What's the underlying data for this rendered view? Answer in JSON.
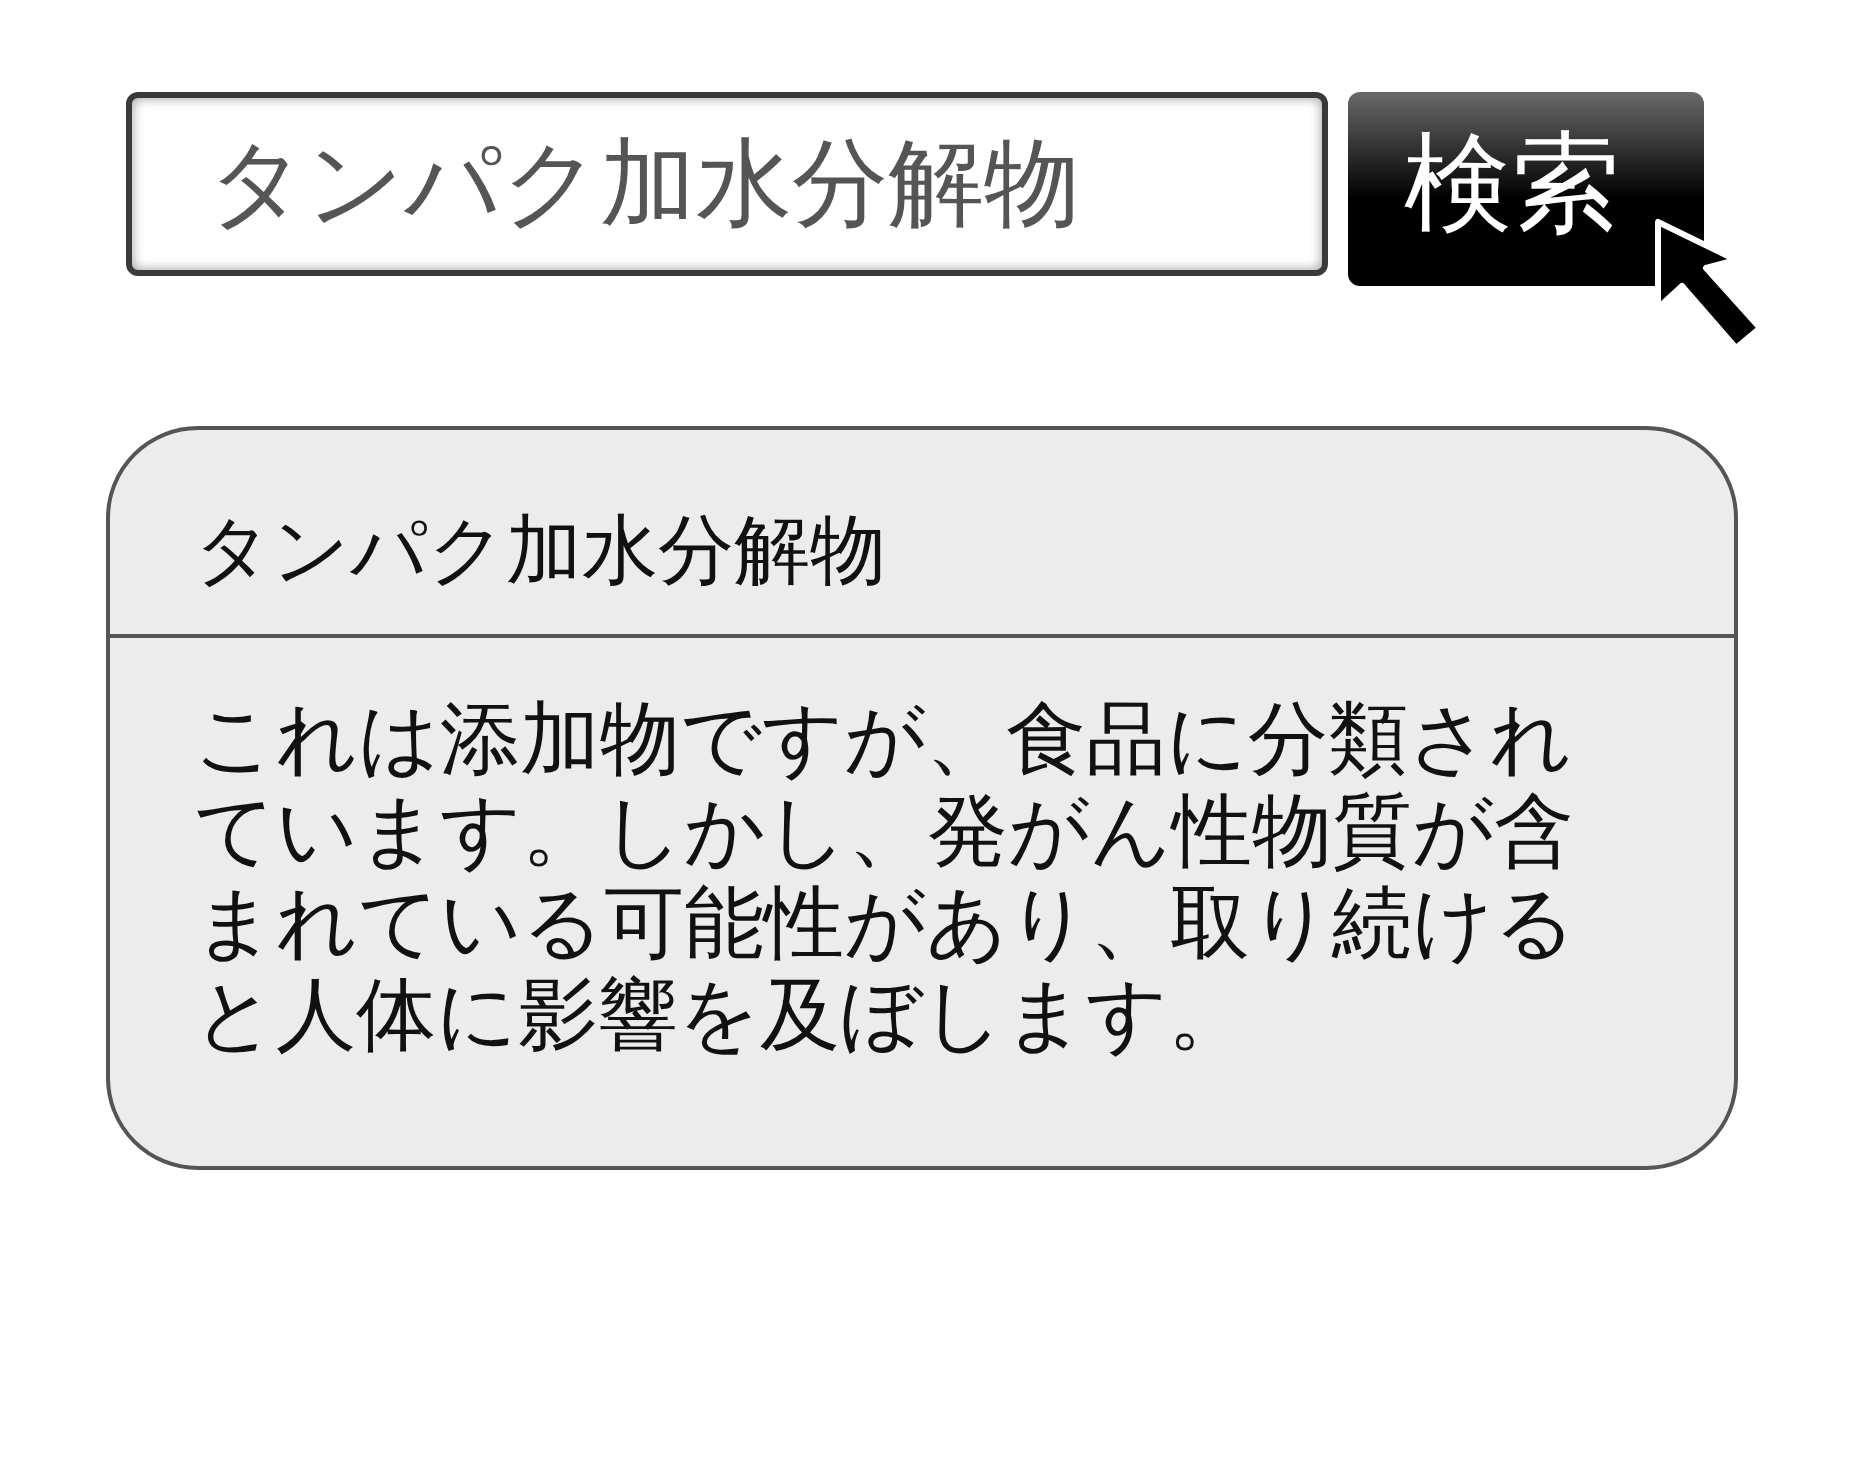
{
  "search": {
    "value": "タンパク加水分解物",
    "button": "検索"
  },
  "result": {
    "title": "タンパク加水分解物",
    "body": "これは添加物ですが、食品に分類されています。しかし、発がん性物質が含まれている可能性があり、取り続けると人体に影響を及ぼします。"
  }
}
